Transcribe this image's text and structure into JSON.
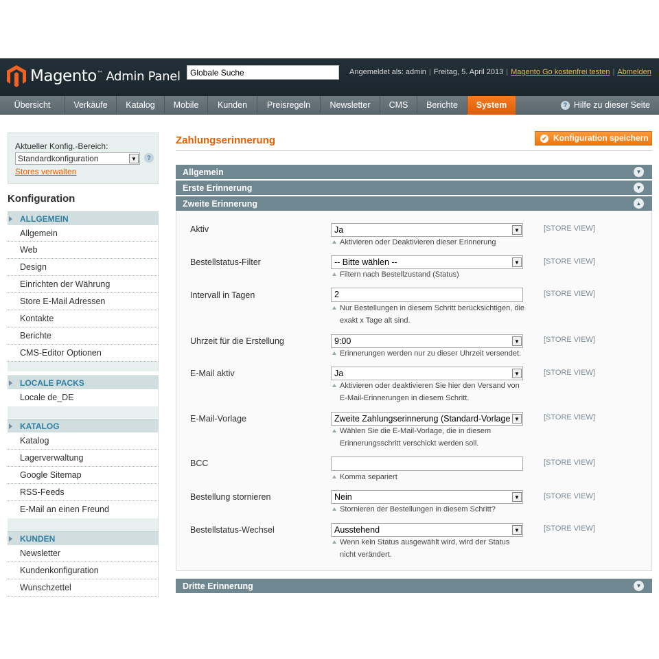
{
  "header": {
    "logo_word": "Magento",
    "logo_tm": "™",
    "logo_sub": "Admin Panel",
    "search_value": "Globale Suche",
    "logged_in": "Angemeldet als: admin",
    "date": "Freitag, 5. April 2013",
    "go_link": "Magento Go kostenfrei testen",
    "logout": "Abmelden"
  },
  "nav": {
    "items": [
      "Übersicht",
      "Verkäufe",
      "Katalog",
      "Mobile",
      "Kunden",
      "Preisregeln",
      "Newsletter",
      "CMS",
      "Berichte",
      "System"
    ],
    "active": "System",
    "help": "Hilfe zu dieser Seite"
  },
  "sidebar": {
    "scope_label": "Aktueller Konfig.-Bereich:",
    "scope_value": "Standardkonfiguration",
    "stores_link": "Stores verwalten",
    "title": "Konfiguration",
    "sections": [
      {
        "label": "ALLGEMEIN",
        "items": [
          "Allgemein",
          "Web",
          "Design",
          "Einrichten der Währung",
          "Store E-Mail Adressen",
          "Kontakte",
          "Berichte",
          "CMS-Editor Optionen"
        ]
      },
      {
        "label": "LOCALE PACKS",
        "items": [
          "Locale de_DE"
        ]
      },
      {
        "label": "KATALOG",
        "items": [
          "Katalog",
          "Lagerverwaltung",
          "Google Sitemap",
          "RSS-Feeds",
          "E-Mail an einen Freund"
        ]
      },
      {
        "label": "KUNDEN",
        "items": [
          "Newsletter",
          "Kundenkonfiguration",
          "Wunschzettel"
        ]
      }
    ]
  },
  "main": {
    "title": "Zahlungserinnerung",
    "save_button": "Konfiguration speichern",
    "groups": [
      "Allgemein",
      "Erste Erinnerung",
      "Zweite Erinnerung",
      "Dritte Erinnerung"
    ],
    "scope_tag": "[STORE VIEW]",
    "fields": [
      {
        "label": "Aktiv",
        "value": "Ja",
        "type": "select",
        "hint": [
          "Aktivieren oder Deaktivieren dieser Erinnerung"
        ]
      },
      {
        "label": "Bestellstatus-Filter",
        "value": "-- Bitte wählen --",
        "type": "select",
        "hint": [
          "Filtern nach Bestellzustand (Status)"
        ]
      },
      {
        "label": "Intervall in Tagen",
        "value": "2",
        "type": "text",
        "hint": [
          "Nur Bestellungen in diesem Schritt berücksichtigen, die",
          "exakt x Tage alt sind."
        ]
      },
      {
        "label": "Uhrzeit für die Erstellung",
        "value": "9:00",
        "type": "select",
        "hint": [
          "Erinnerungen werden nur zu dieser Uhrzeit versendet."
        ]
      },
      {
        "label": "E-Mail aktiv",
        "value": "Ja",
        "type": "select",
        "hint": [
          "Aktivieren oder deaktivieren Sie hier den Versand von",
          "E-Mail-Erinnerungen in diesem Schritt."
        ]
      },
      {
        "label": "E-Mail-Vorlage",
        "value": "Zweite Zahlungserinnerung (Standard-Vorlage",
        "type": "select",
        "hint": [
          "Wählen Sie die E-Mail-Vorlage, die in diesem",
          "Erinnerungsschritt verschickt werden soll."
        ]
      },
      {
        "label": "BCC",
        "value": "",
        "type": "text",
        "hint": [
          "Komma separiert"
        ]
      },
      {
        "label": "Bestellung stornieren",
        "value": "Nein",
        "type": "select",
        "hint": [
          "Stornieren der Bestellungen in diesem Schritt?"
        ]
      },
      {
        "label": "Bestellstatus-Wechsel",
        "value": "Ausstehend",
        "type": "select",
        "hint": [
          "Wenn kein Status ausgewählt wird, wird der Status",
          "nicht verändert."
        ]
      }
    ]
  },
  "colors": {
    "accent": "#eb5e00",
    "header_bg": "#1f2b32",
    "nav_bg": "#626f75",
    "group_head": "#6f8791",
    "sidebar_head": "#2e7fa4"
  },
  "icons": {
    "logo": "magento-logo-icon",
    "help": "help-icon",
    "save": "check-circle-icon",
    "toggle_down": "chevron-down-circle-icon",
    "toggle_up": "chevron-up-circle-icon",
    "select": "dropdown-arrow-icon"
  }
}
